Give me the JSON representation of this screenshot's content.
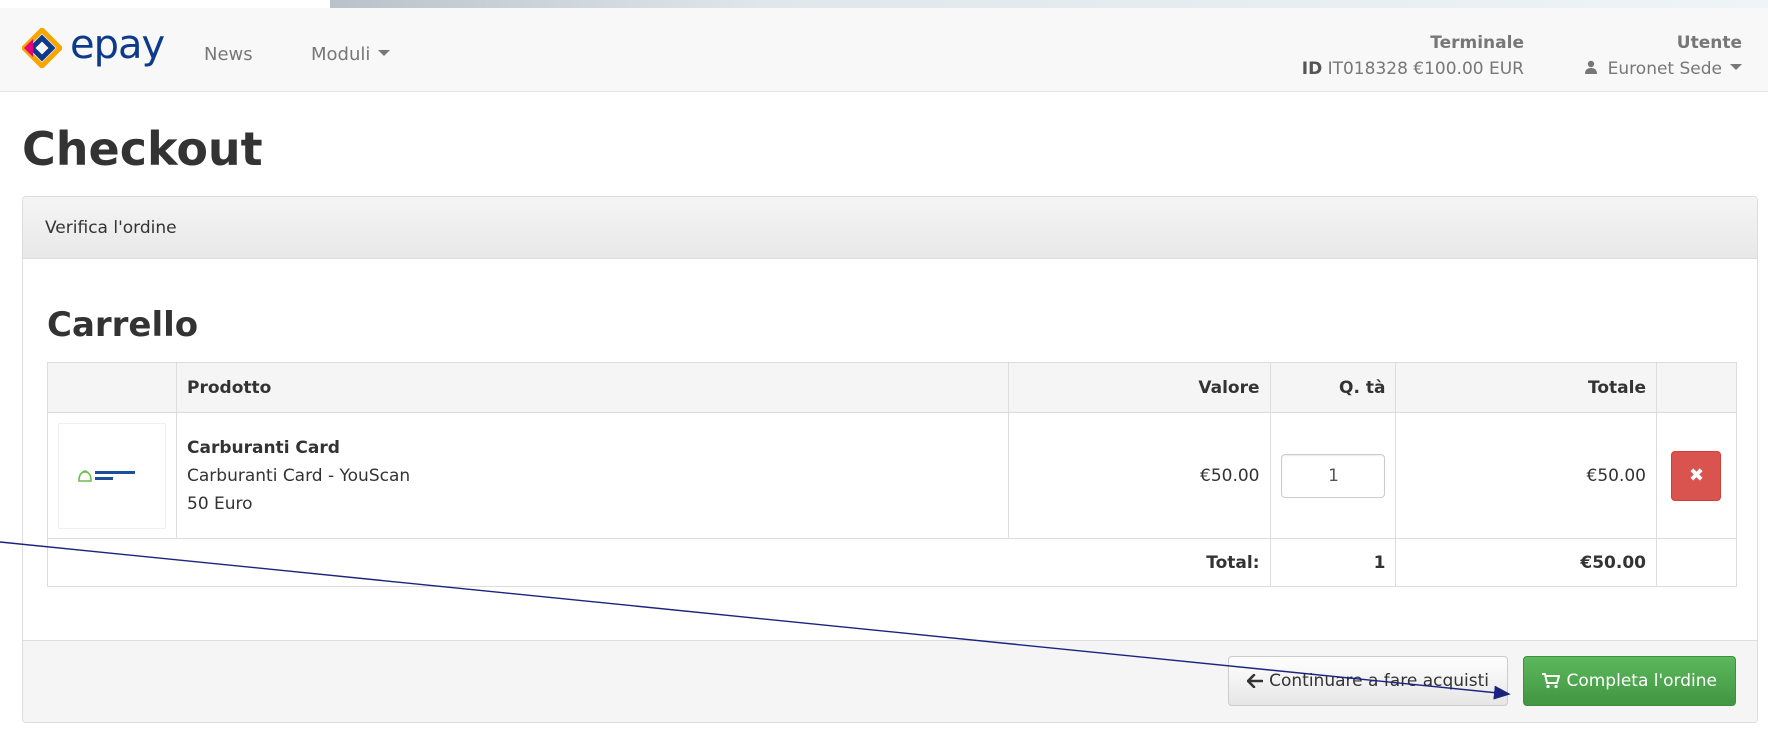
{
  "navbar": {
    "brand": "epay",
    "links": [
      "News",
      "Moduli"
    ],
    "terminal": {
      "heading": "Terminale",
      "id_label": "ID",
      "id_value": "IT018328 €100.00 EUR"
    },
    "user": {
      "heading": "Utente",
      "name": "Euronet Sede"
    }
  },
  "page": {
    "title": "Checkout"
  },
  "panel": {
    "heading": "Verifica l'ordine",
    "cart_title": "Carrello"
  },
  "table": {
    "headers": {
      "product": "Prodotto",
      "value": "Valore",
      "qty": "Q. tà",
      "total": "Totale"
    },
    "rows": [
      {
        "image_text": "Carburanti Card",
        "name": "Carburanti Card",
        "line1": "Carburanti Card - YouScan",
        "line2": "50 Euro",
        "value": "€50.00",
        "qty": "1",
        "total": "€50.00",
        "delete_glyph": "✖"
      }
    ],
    "footer": {
      "label": "Total:",
      "qty": "1",
      "total": "€50.00"
    }
  },
  "buttons": {
    "continue": "Continuare a fare acquisti",
    "complete": "Completa l'ordine"
  },
  "colors": {
    "brand": "#0d3b8c",
    "success": "#5cb85c",
    "danger": "#d9534f",
    "annotation_arrow": "#1a237e"
  },
  "icons": {
    "logo": "epay-diamond-logo",
    "caret": "caret-down-icon",
    "user": "user-icon",
    "back": "arrow-left-icon",
    "cart": "shopping-cart-icon",
    "delete": "close-icon"
  }
}
